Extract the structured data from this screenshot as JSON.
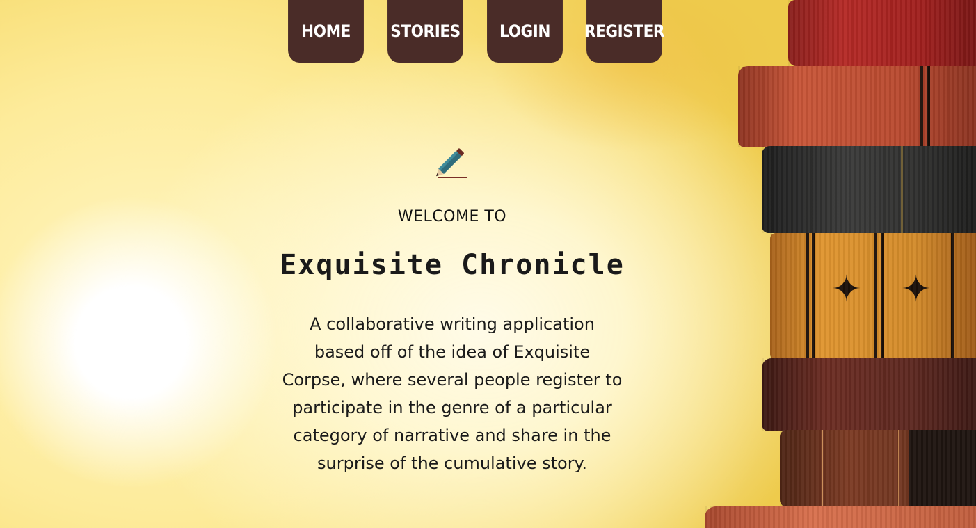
{
  "nav": {
    "items": [
      {
        "label": "HOME"
      },
      {
        "label": "STORIES"
      },
      {
        "label": "LOGIN"
      },
      {
        "label": "REGISTER"
      }
    ]
  },
  "hero": {
    "icon": "pencil-icon",
    "welcome": "WELCOME TO",
    "title": "Exquisite Chronicle",
    "description_lines": [
      "A collaborative writing application",
      "based off of the idea of Exquisite",
      "Corpse, where several people register to",
      "participate in the genre of a particular",
      "category of narrative and share in the",
      "surprise of the cumulative story."
    ]
  },
  "colors": {
    "nav_bg": "#4a2c28",
    "nav_text": "#ffffff",
    "text": "#1a1a1a"
  }
}
